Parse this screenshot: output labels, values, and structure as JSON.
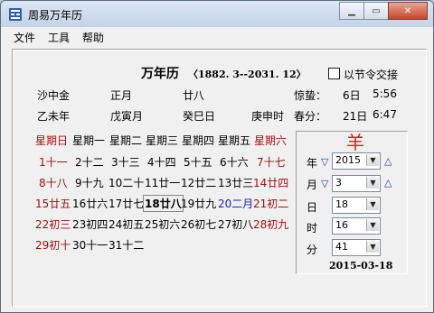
{
  "window": {
    "title": "周易万年历",
    "min_icon": "minimize-icon",
    "max_icon": "maximize-icon",
    "close_label": "✕"
  },
  "menu": [
    "文件",
    "工具",
    "帮助"
  ],
  "header": {
    "title": "万年历",
    "range": "〈1882. 3--2031. 12〉",
    "checkbox_label": "以节令交接",
    "checkbox_checked": false
  },
  "info": {
    "row1": [
      "沙中金",
      "正月",
      "廿八"
    ],
    "row2": [
      "乙未年",
      "戊寅月",
      "癸巳日",
      "庚申时"
    ],
    "jingzhe_label": "惊蛰：",
    "jingzhe_day": "6日",
    "jingzhe_time": "5:56",
    "chunfen_label": "春分：",
    "chunfen_day": "21日",
    "chunfen_time": "6:47"
  },
  "weekdays": [
    "星期日",
    "星期一",
    "星期二",
    "星期三",
    "星期四",
    "星期五",
    "星期六"
  ],
  "calendar": [
    [
      "",
      "",
      "",
      "",
      "",
      "",
      ""
    ],
    [
      "1十一",
      "2十二",
      "3十三",
      "4十四",
      "5十五",
      "6十六",
      "7十七"
    ],
    [
      "8十八",
      "9十九",
      "10二十",
      "11廿一",
      "12廿二",
      "13廿三",
      "14廿四"
    ],
    [
      "15廿五",
      "16廿六",
      "17廿七",
      "18廿八",
      "19廿九",
      "20二月",
      "21初二"
    ],
    [
      "22初三",
      "23初四",
      "24初五",
      "25初六",
      "26初七",
      "27初八",
      "28初九"
    ],
    [
      "29初十",
      "30十一",
      "31十二",
      "",
      "",
      "",
      ""
    ]
  ],
  "zodiac": "羊",
  "controls": {
    "year_label": "年",
    "year_value": "2015",
    "month_label": "月",
    "month_value": "3",
    "day_label": "日",
    "day_value": "18",
    "hour_label": "时",
    "hour_value": "16",
    "minute_label": "分",
    "minute_value": "41"
  },
  "date_footer": "2015-03-18",
  "colors": {
    "weekend_red": "#a01010",
    "highlight_blue": "#2020c0",
    "zodiac_red": "#e01a1a"
  }
}
